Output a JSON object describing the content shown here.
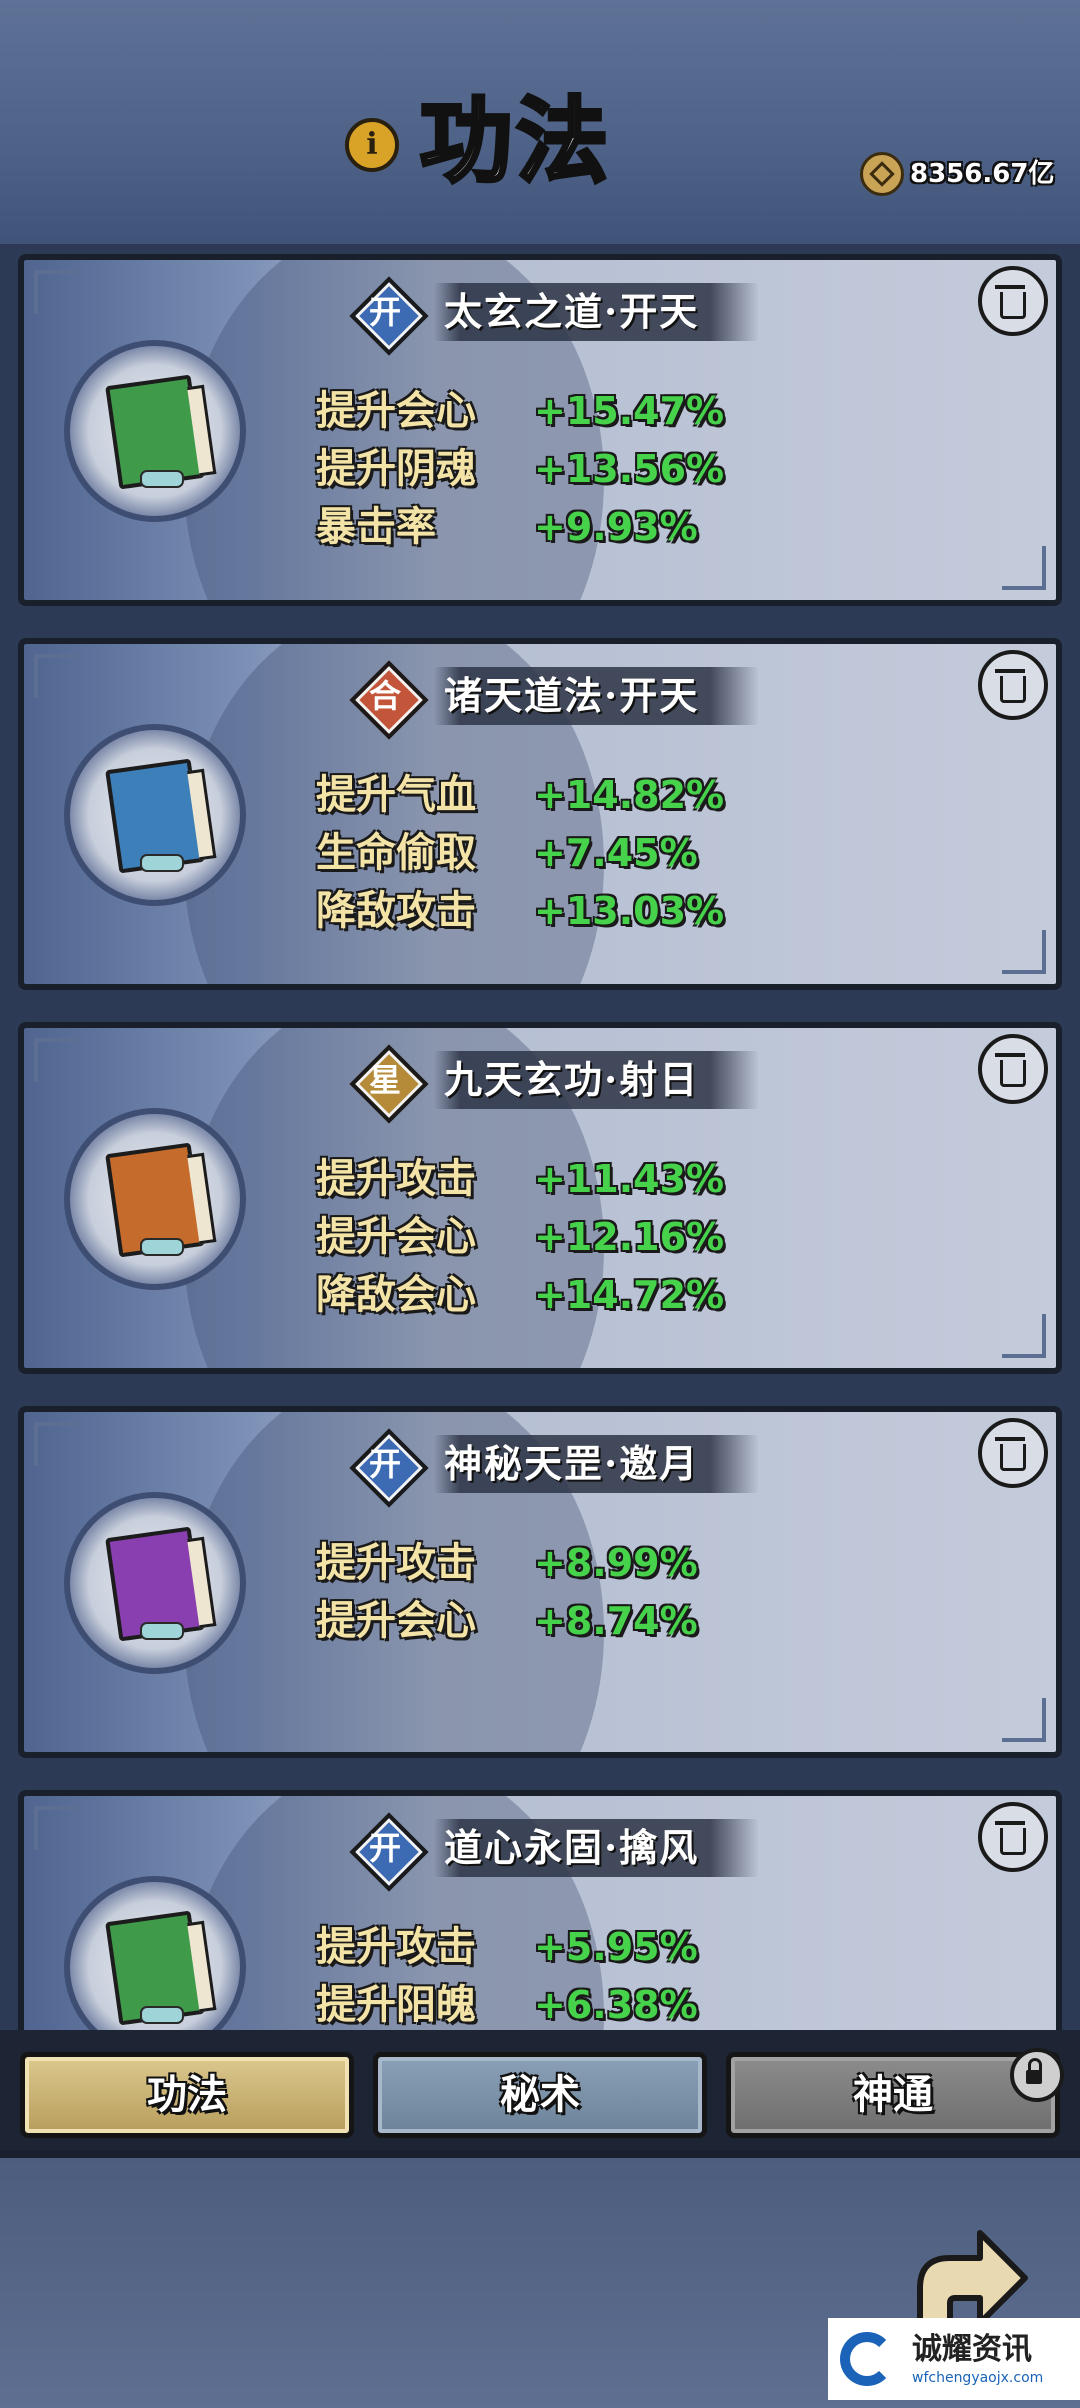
{
  "header": {
    "title": "功法",
    "info_icon": "i",
    "currency_amount": "8356.67亿"
  },
  "colors": {
    "label": "#f3e3a6",
    "value": "#46d24a",
    "book_green": "#3f9a4a",
    "book_blue": "#3d7fb8",
    "book_orange": "#c56b2b",
    "book_purple": "#8a3fb0"
  },
  "skills": [
    {
      "badge": "开",
      "badge_color": "#3c6ab3",
      "book_color": "#3f9a4a",
      "name": "太玄之道·开天",
      "stats": [
        {
          "label": "提升会心",
          "value": "+15.47%"
        },
        {
          "label": "提升阴魂",
          "value": "+13.56%"
        },
        {
          "label": "暴击率",
          "value": "+9.93%"
        }
      ]
    },
    {
      "badge": "合",
      "badge_color": "#c3553a",
      "book_color": "#3d7fb8",
      "name": "诸天道法·开天",
      "stats": [
        {
          "label": "提升气血",
          "value": "+14.82%"
        },
        {
          "label": "生命偷取",
          "value": "+7.45%"
        },
        {
          "label": "降敌攻击",
          "value": "+13.03%"
        }
      ]
    },
    {
      "badge": "星",
      "badge_color": "#b58b3a",
      "book_color": "#c56b2b",
      "name": "九天玄功·射日",
      "stats": [
        {
          "label": "提升攻击",
          "value": "+11.43%"
        },
        {
          "label": "提升会心",
          "value": "+12.16%"
        },
        {
          "label": "降敌会心",
          "value": "+14.72%"
        }
      ]
    },
    {
      "badge": "开",
      "badge_color": "#3c6ab3",
      "book_color": "#8a3fb0",
      "name": "神秘天罡·邀月",
      "stats": [
        {
          "label": "提升攻击",
          "value": "+8.99%"
        },
        {
          "label": "提升会心",
          "value": "+8.74%"
        }
      ]
    },
    {
      "badge": "开",
      "badge_color": "#3c6ab3",
      "book_color": "#3f9a4a",
      "name": "道心永固·擒风",
      "stats": [
        {
          "label": "提升攻击",
          "value": "+5.95%"
        },
        {
          "label": "提升阳魄",
          "value": "+6.38%"
        }
      ]
    }
  ],
  "tabs": {
    "t1": "功法",
    "t2": "秘术",
    "t3": "神通"
  },
  "watermark": {
    "cn": "诚耀资讯",
    "en": "wfchengyaojx.com"
  }
}
